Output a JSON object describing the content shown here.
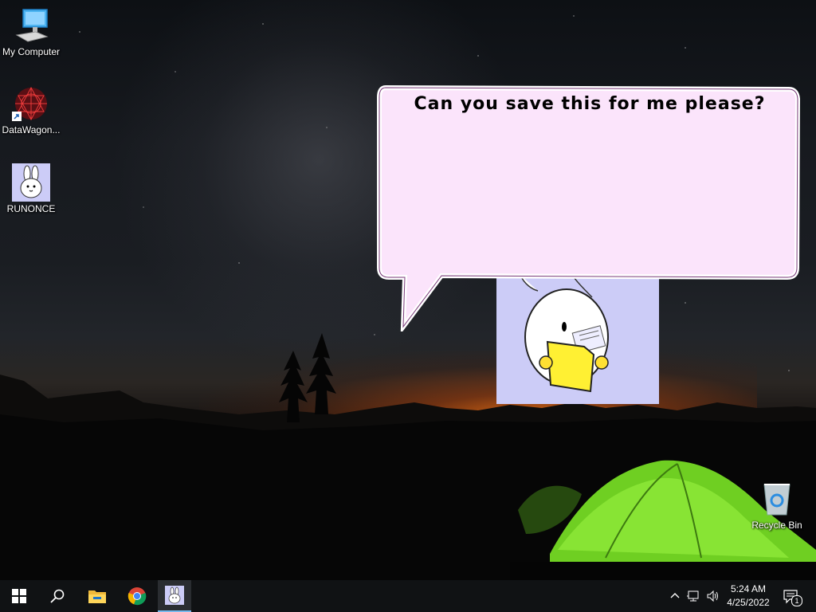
{
  "desktop": {
    "icons": [
      {
        "label": "My Computer",
        "icon": "computer-icon"
      },
      {
        "label": "DataWagon...",
        "icon": "datawagon-icon"
      },
      {
        "label": "RUNONCE",
        "icon": "bunny-icon"
      }
    ],
    "recycle_bin": {
      "label": "Recycle Bin",
      "icon": "recycle-bin-icon"
    }
  },
  "bubble": {
    "text": "Can you save this for me please?",
    "fill_color": "#fbe4fb"
  },
  "mascot": {
    "icon": "bunny-holding-folder-icon",
    "bg_color": "#ccccf7"
  },
  "taskbar": {
    "buttons": [
      {
        "icon": "windows-start-icon"
      },
      {
        "icon": "search-icon"
      },
      {
        "icon": "file-explorer-icon"
      },
      {
        "icon": "chrome-icon"
      },
      {
        "icon": "bunny-app-icon",
        "active": true
      }
    ],
    "tray": {
      "time": "5:24 AM",
      "date": "4/25/2022",
      "notification_count": "1"
    }
  }
}
